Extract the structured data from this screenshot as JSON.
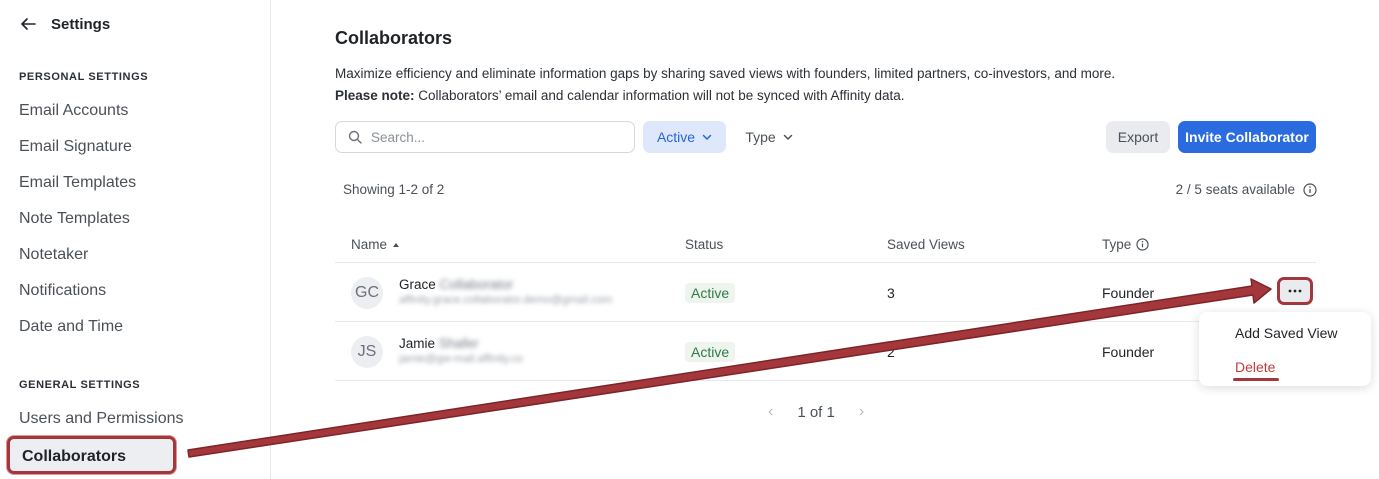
{
  "sidebar": {
    "title": "Settings",
    "personal_heading": "PERSONAL SETTINGS",
    "personal_items": [
      "Email Accounts",
      "Email Signature",
      "Email Templates",
      "Note Templates",
      "Notetaker",
      "Notifications",
      "Date and Time"
    ],
    "general_heading": "GENERAL SETTINGS",
    "general_items": [
      "Users and Permissions",
      "Collaborators"
    ]
  },
  "main": {
    "title": "Collaborators",
    "description": "Maximize efficiency and eliminate information gaps by sharing saved views with founders, limited partners, co-investors, and more.",
    "note_label": "Please note:",
    "note_text": " Collaborators’ email and calendar information will not be synced with Affinity data.",
    "search_placeholder": "Search...",
    "filter_active": "Active",
    "filter_type": "Type",
    "export_label": "Export",
    "invite_label": "Invite Collaborator",
    "showing": "Showing 1-2 of 2",
    "seats": "2 / 5 seats available"
  },
  "table": {
    "columns": [
      "Name",
      "Status",
      "Saved Views",
      "Type"
    ],
    "rows": [
      {
        "initials": "GC",
        "first": "Grace",
        "last": "Collaborator",
        "email": "affinity.grace.collaborator.demo@gmail.com",
        "status": "Active",
        "views": "3",
        "type": "Founder"
      },
      {
        "initials": "JS",
        "first": "Jamie",
        "last": "Shafer",
        "email": "jamie@gw-mail.affinity.co",
        "status": "Active",
        "views": "2",
        "type": "Founder"
      }
    ]
  },
  "pagination": {
    "label": "1 of 1"
  },
  "menu": {
    "items": [
      "Add Saved View",
      "Delete"
    ]
  },
  "colors": {
    "accent": "#2a6be0",
    "annotation": "#a4373b",
    "status_green": "#2f7a45",
    "delete_red": "#c63b3b"
  }
}
